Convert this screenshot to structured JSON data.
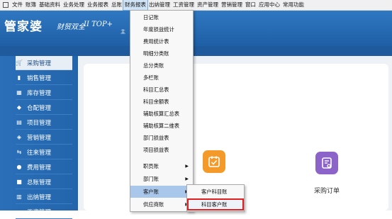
{
  "menubar": {
    "items": [
      "文件",
      "账簿",
      "基础资料",
      "业务处理",
      "业务报表",
      "总账",
      "财务报表",
      "出纳管理",
      "工资管理",
      "资产管理",
      "营销管理",
      "窗口",
      "应用中心",
      "常用功能"
    ]
  },
  "header": {
    "logo_main": "管家婆",
    "logo_sub": "财贸双全",
    "logo_version": "II TOP+",
    "tab_label": "主"
  },
  "sidebar": {
    "items": [
      {
        "label": "采购管理",
        "icon": "cart-icon",
        "active": true
      },
      {
        "label": "销售管理",
        "icon": "bar-chart-icon",
        "active": false
      },
      {
        "label": "库存管理",
        "icon": "warehouse-icon",
        "active": false
      },
      {
        "label": "仓配管理",
        "icon": "box-icon",
        "active": false
      },
      {
        "label": "项目管理",
        "icon": "folder-icon",
        "active": false
      },
      {
        "label": "营销管理",
        "icon": "tag-icon",
        "active": false
      },
      {
        "label": "往来管理",
        "icon": "transfer-icon",
        "active": false
      },
      {
        "label": "费用管理",
        "icon": "money-icon",
        "active": false
      },
      {
        "label": "总账管理",
        "icon": "ledger-icon",
        "active": false
      },
      {
        "label": "出纳管理",
        "icon": "cashier-icon",
        "active": false
      },
      {
        "label": "工资管理",
        "icon": "salary-icon",
        "active": false
      }
    ]
  },
  "dropdown": {
    "items": [
      {
        "label": "日记账",
        "has_sub": false
      },
      {
        "label": "年度损益统计",
        "has_sub": false
      },
      {
        "label": "费用统计表",
        "has_sub": false
      },
      {
        "label": "明细分类账",
        "has_sub": false
      },
      {
        "label": "总分类账",
        "has_sub": false
      },
      {
        "label": "多栏账",
        "has_sub": false
      },
      {
        "label": "科目汇总表",
        "has_sub": false
      },
      {
        "label": "科目余额表",
        "has_sub": false
      },
      {
        "label": "辅助核算汇总表",
        "has_sub": false
      },
      {
        "label": "辅助核算二维表",
        "has_sub": false
      },
      {
        "label": "部门损益表",
        "has_sub": false
      },
      {
        "label": "项目损益表",
        "has_sub": false
      },
      {
        "label": "职员账",
        "has_sub": true
      },
      {
        "label": "部门账",
        "has_sub": true
      },
      {
        "label": "客户账",
        "has_sub": true
      },
      {
        "label": "供应商账",
        "has_sub": true
      }
    ]
  },
  "submenu": {
    "items": [
      "客户科目账",
      "科目客户账"
    ]
  },
  "content": {
    "tile2_caption": "采购订单"
  }
}
